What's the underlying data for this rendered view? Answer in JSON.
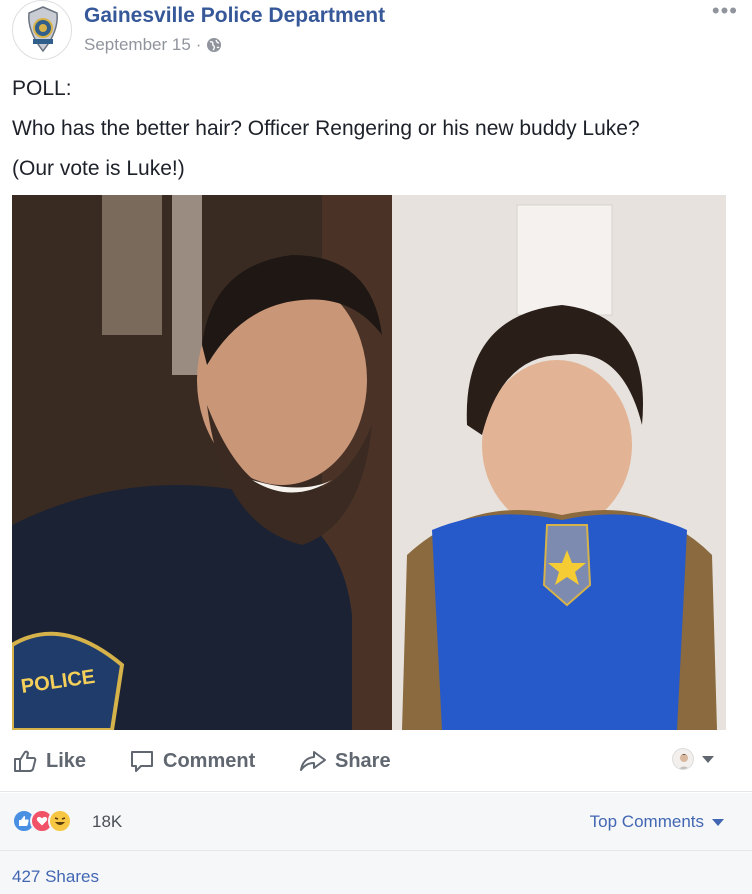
{
  "post": {
    "page_name": "Gainesville Police Department",
    "date": "September 15",
    "separator": "·",
    "audience_icon": "globe-icon",
    "more_icon": "•••",
    "text_lines": [
      "POLL:",
      "Who has the better hair? Officer Rengering or his new buddy Luke?",
      "(Our vote is Luke!)"
    ],
    "photo_badge_text": "POLICE"
  },
  "actions": {
    "like_label": "Like",
    "comment_label": "Comment",
    "share_label": "Share"
  },
  "reactions": {
    "types": [
      "like",
      "love",
      "haha"
    ],
    "count": "18K",
    "sort_label": "Top Comments"
  },
  "shares": {
    "label": "427 Shares"
  },
  "colors": {
    "link_blue": "#365899",
    "accent_blue": "#4267b2",
    "muted_gray": "#90949c",
    "like_blue": "#4a90e2",
    "love_red": "#f25268",
    "haha_yellow": "#f7c744"
  }
}
